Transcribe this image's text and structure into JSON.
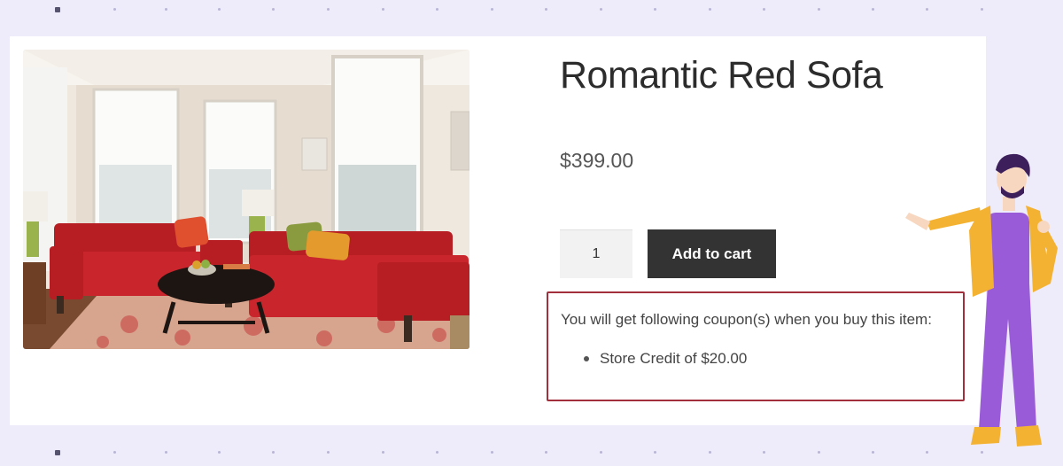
{
  "product": {
    "title": "Romantic Red Sofa",
    "price": "$399.00",
    "quantity": "1",
    "add_to_cart_label": "Add to cart",
    "image_alt": "Living room with red sofas"
  },
  "coupon": {
    "intro": "You will get following coupon(s) when you buy this item:",
    "items": [
      {
        "label": "Store Credit of $20.00"
      }
    ],
    "highlight_color": "#a12f3c"
  },
  "colors": {
    "background": "#eeecfb",
    "button": "#333333",
    "sofa": "#c8262c",
    "presenter_jacket": "#f4b233",
    "presenter_outfit": "#9a5bd8"
  }
}
